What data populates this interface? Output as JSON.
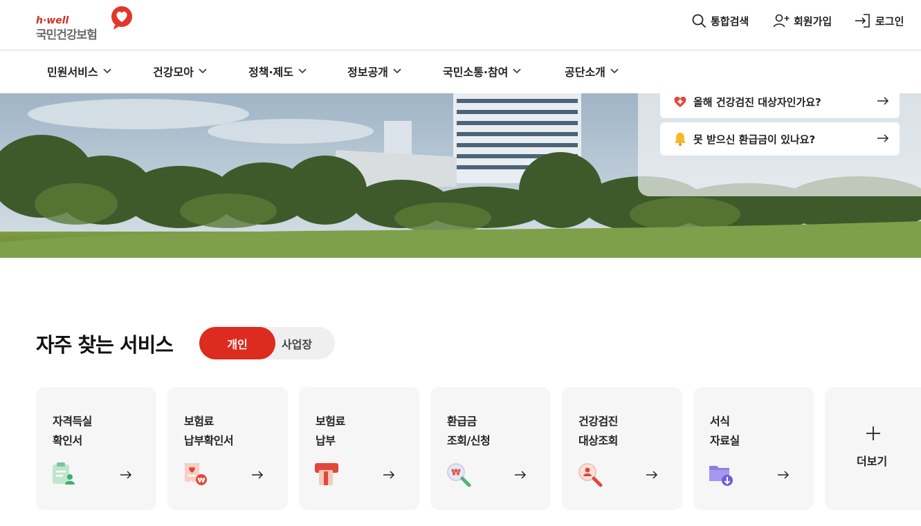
{
  "logo": {
    "brand": "h·well",
    "name": "국민건강보험"
  },
  "utility": {
    "search": "통합검색",
    "signup": "회원가입",
    "login": "로그인"
  },
  "gnb": [
    "민원서비스",
    "건강모아",
    "정책·제도",
    "정보공개",
    "국민소통·참여",
    "공단소개"
  ],
  "quick_links": [
    {
      "label": "올해 건강검진 대상자인가요?",
      "icon": "heart-plus-icon"
    },
    {
      "label": "못 받으신 환급금이 있나요?",
      "icon": "bell-icon"
    }
  ],
  "section": {
    "title": "자주 찾는 서비스",
    "toggle_active": "개인",
    "toggle_inactive": "사업장"
  },
  "services": [
    {
      "line1": "자격득실",
      "line2": "확인서",
      "icon": "clipboard-user-icon"
    },
    {
      "line1": "보험료",
      "line2": "납부확인서",
      "icon": "receipt-won-icon"
    },
    {
      "line1": "보험료",
      "line2": "납부",
      "icon": "card-payment-icon"
    },
    {
      "line1": "환급금",
      "line2": "조회/신청",
      "icon": "search-won-icon"
    },
    {
      "line1": "건강검진",
      "line2": "대상조회",
      "icon": "search-person-icon"
    },
    {
      "line1": "서식",
      "line2": "자료실",
      "icon": "folder-download-icon"
    }
  ],
  "more": {
    "label": "더보기"
  },
  "colors": {
    "accent": "#de2b1f",
    "card_bg": "#f6f6f6"
  }
}
